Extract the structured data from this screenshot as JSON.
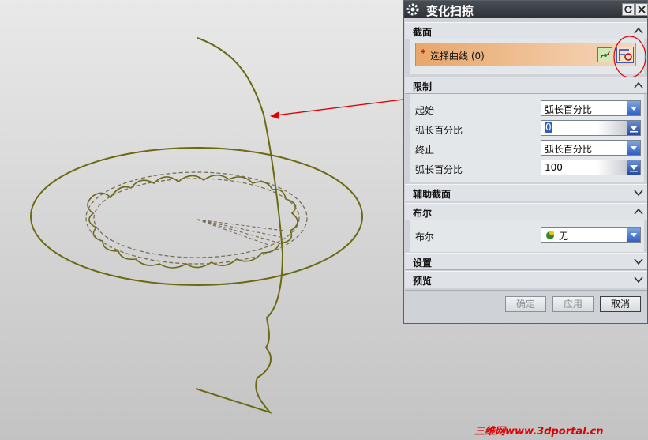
{
  "dialog": {
    "title": "变化扫掠",
    "sections": {
      "section_header": "截面",
      "limits": "限制",
      "aux_section": "辅助截面",
      "boolean": "布尔",
      "settings": "设置",
      "preview": "预览"
    },
    "select_curve": {
      "required_mark": "*",
      "label": "选择曲线 (0)"
    },
    "limits": {
      "start_label": "起始",
      "start_value": "弧长百分比",
      "start_percent_label": "弧长百分比",
      "start_percent_value": "0",
      "end_label": "终止",
      "end_value": "弧长百分比",
      "end_percent_label": "弧长百分比",
      "end_percent_value": "100"
    },
    "boolean": {
      "label": "布尔",
      "value": "无"
    },
    "buttons": {
      "ok": "确定",
      "apply": "应用",
      "cancel": "取消"
    }
  },
  "watermark": "三维网www.3dportal.cn",
  "colors": {
    "curve": "#6b6a12",
    "arrow": "#e00000",
    "section_bar": "#e8a66a",
    "dropdown_button": "#2f5fc4"
  },
  "icons": [
    "gear-icon",
    "reset-icon",
    "close-icon",
    "curve-select-icon",
    "section-builder-icon",
    "chevron-up-icon",
    "chevron-down-icon",
    "dropdown-arrow-icon",
    "boolean-none-icon"
  ]
}
